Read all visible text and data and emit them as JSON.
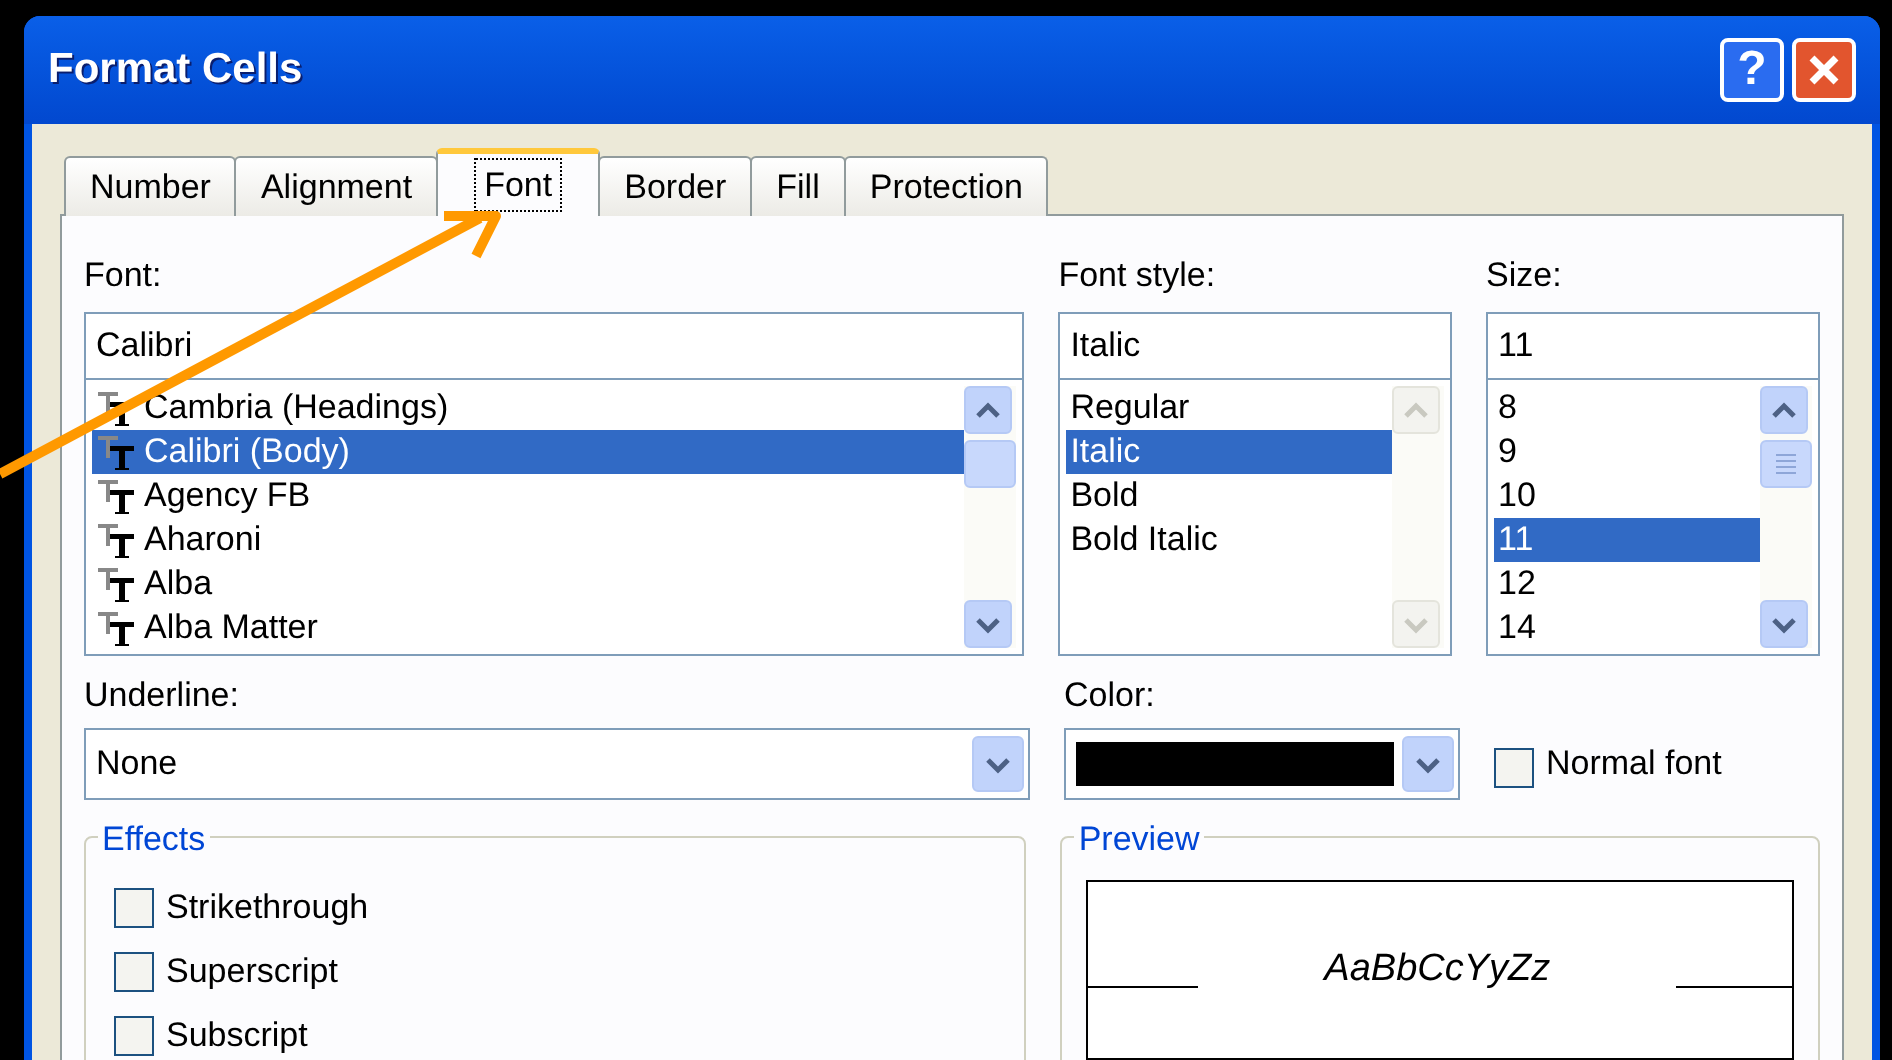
{
  "window": {
    "title": "Format Cells",
    "buttons": [
      {
        "kind": "help",
        "label": "?"
      },
      {
        "kind": "close"
      }
    ]
  },
  "tabs": [
    {
      "label": "Number",
      "selected": false
    },
    {
      "label": "Alignment",
      "selected": false
    },
    {
      "label": "Font",
      "selected": true
    },
    {
      "label": "Border",
      "selected": false
    },
    {
      "label": "Fill",
      "selected": false
    },
    {
      "label": "Protection",
      "selected": false
    }
  ],
  "font": {
    "label": "Font:",
    "value": "Calibri",
    "scrollbar_enabled": true,
    "items": [
      {
        "label": "Cambria (Headings)",
        "selected": false
      },
      {
        "label": "Calibri (Body)",
        "selected": true
      },
      {
        "label": "Agency FB",
        "selected": false
      },
      {
        "label": "Aharoni",
        "selected": false
      },
      {
        "label": "Alba",
        "selected": false
      },
      {
        "label": "Alba Matter",
        "selected": false
      }
    ]
  },
  "font_style": {
    "label": "Font style:",
    "value": "Italic",
    "scrollbar_enabled": false,
    "items": [
      {
        "label": "Regular",
        "selected": false
      },
      {
        "label": "Italic",
        "selected": true
      },
      {
        "label": "Bold",
        "selected": false
      },
      {
        "label": "Bold Italic",
        "selected": false
      }
    ]
  },
  "size": {
    "label": "Size:",
    "value": "11",
    "scrollbar_enabled": true,
    "items": [
      {
        "label": "8",
        "selected": false
      },
      {
        "label": "9",
        "selected": false
      },
      {
        "label": "10",
        "selected": false
      },
      {
        "label": "11",
        "selected": true
      },
      {
        "label": "12",
        "selected": false
      },
      {
        "label": "14",
        "selected": false
      }
    ]
  },
  "underline": {
    "label": "Underline:",
    "value": "None"
  },
  "color": {
    "label": "Color:",
    "color": "#000000"
  },
  "normal_font": {
    "label": "Normal font",
    "checked": false
  },
  "effects": {
    "title": "Effects",
    "options": [
      {
        "label": "Strikethrough",
        "checked": false
      },
      {
        "label": "Superscript",
        "checked": false
      },
      {
        "label": "Subscript",
        "checked": false
      }
    ]
  },
  "preview": {
    "title": "Preview",
    "sample": "AaBbCcYyZz"
  }
}
